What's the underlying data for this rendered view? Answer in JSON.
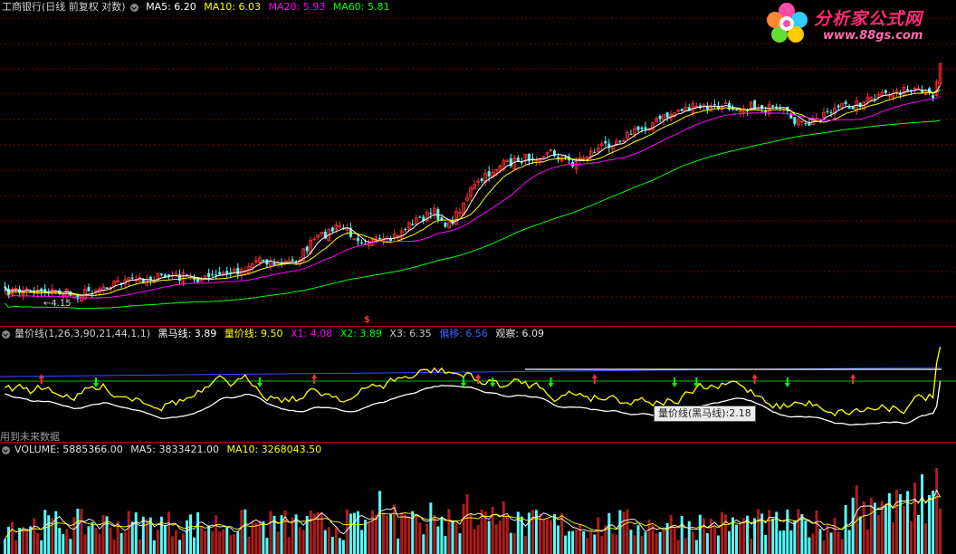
{
  "main": {
    "title": "工商银行(日线 前复权 对数)",
    "ma5": "MA5: 6.20",
    "ma10": "MA10: 6.03",
    "ma20": "MA20: 5.93",
    "ma60": "MA60: 5.81",
    "low_label": "←4.15",
    "marker": "$",
    "colors": {
      "ma5": "#ffffff",
      "ma10": "#ffff00",
      "ma20": "#ff00ff",
      "ma60": "#00ff00",
      "up": "#ff3030",
      "down": "#54fcfc"
    }
  },
  "logo": {
    "title": "分析家公式网",
    "url": "www.88gs.com"
  },
  "indicator": {
    "name": "量价线(1,26,3,90,21,44,1,1)",
    "heima": "黑马线: 3.89",
    "liangjia": "量价线: 9.50",
    "x1": "X1: 4.08",
    "x2": "X2: 3.89",
    "x3": "X3: 6.35",
    "pianyi": "偏移: 6.56",
    "guancha": "观察: 6.09",
    "tooltip": "量价线(黑马线):2.18",
    "future_note": "用到未来数据"
  },
  "volume": {
    "volume": "VOLUME: 5885366.00",
    "ma5": "MA5: 3833421.00",
    "ma10": "MA10: 3268043.50"
  }
}
